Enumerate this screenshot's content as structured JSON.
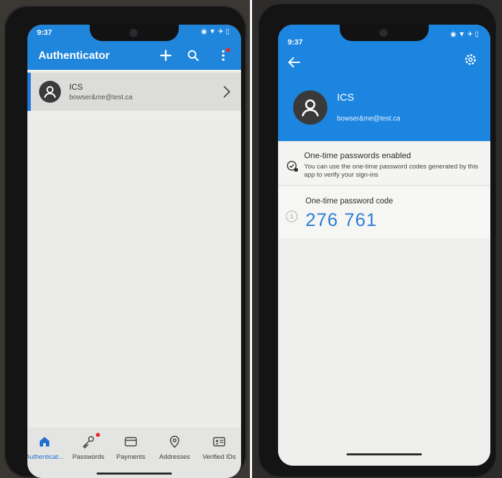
{
  "left_screen": {
    "status_time": "9:37",
    "app_title": "Authenticator",
    "account": {
      "name": "ICS",
      "email": "bowser&me@test.ca"
    },
    "bottom_nav": [
      {
        "label": "Authenticat...",
        "icon": "home-icon",
        "active": true
      },
      {
        "label": "Passwords",
        "icon": "key-icon",
        "active": false,
        "notification_dot": true
      },
      {
        "label": "Payments",
        "icon": "credit-card-icon",
        "active": false
      },
      {
        "label": "Addresses",
        "icon": "location-pin-icon",
        "active": false
      },
      {
        "label": "Verified IDs",
        "icon": "id-card-icon",
        "active": false
      }
    ],
    "appbar_actions": [
      "add-icon",
      "search-icon",
      "more-vertical-icon"
    ],
    "menu_notification_dot": true
  },
  "right_screen": {
    "status_time": "9:37",
    "account": {
      "name": "ICS",
      "email": "bowser&me@test.ca"
    },
    "otp_status": {
      "title": "One-time passwords enabled",
      "description": "You can use the one-time password codes generated by this app to verify your sign-ins"
    },
    "otp_code": {
      "label": "One-time password code",
      "value": "276 761",
      "timer_value": "1"
    }
  },
  "colors": {
    "brand_blue": "#1f86dc",
    "code_blue": "#2c7fd5",
    "notification_red": "#e82a2a"
  }
}
